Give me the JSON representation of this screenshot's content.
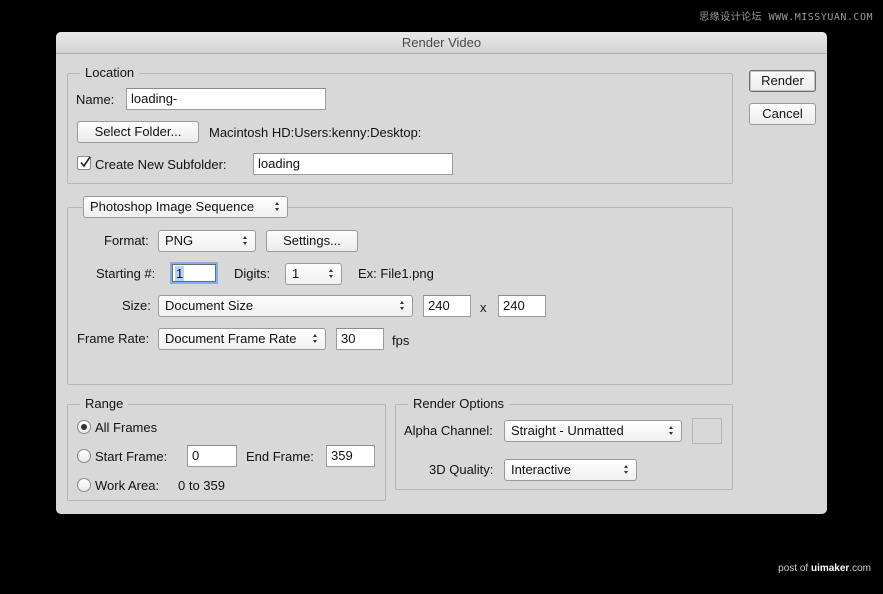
{
  "watermarks": {
    "top": "思缘设计论坛 WWW.MISSYUAN.COM",
    "bottom_prefix": "post of ",
    "bottom_brand": "uimaker",
    "bottom_suffix": ".com"
  },
  "dialog": {
    "title": "Render Video",
    "buttons": {
      "render": "Render",
      "cancel": "Cancel"
    },
    "location": {
      "legend": "Location",
      "name_label": "Name:",
      "name_value": "loading-",
      "select_folder_label": "Select Folder...",
      "folder_path": "Macintosh HD:Users:kenny:Desktop:",
      "create_subfolder_label": "Create New Subfolder:",
      "create_subfolder_checked": true,
      "subfolder_value": "loading"
    },
    "export": {
      "type_selected": "Photoshop Image Sequence",
      "format_label": "Format:",
      "format_selected": "PNG",
      "settings_label": "Settings...",
      "starting_label": "Starting #:",
      "starting_value": "1",
      "digits_label": "Digits:",
      "digits_selected": "1",
      "example_text": "Ex: File1.png",
      "size_label": "Size:",
      "size_selected": "Document Size",
      "width_value": "240",
      "x_label": "x",
      "height_value": "240",
      "frame_rate_label": "Frame Rate:",
      "frame_rate_selected": "Document Frame Rate",
      "fps_value": "30",
      "fps_label": "fps"
    },
    "range": {
      "legend": "Range",
      "all_frames_label": "All Frames",
      "selected": "All Frames",
      "start_frame_label": "Start Frame:",
      "start_frame_value": "0",
      "end_frame_label": "End Frame:",
      "end_frame_value": "359",
      "work_area_label": "Work Area:",
      "work_area_value": "0 to 359"
    },
    "render_options": {
      "legend": "Render Options",
      "alpha_label": "Alpha Channel:",
      "alpha_selected": "Straight - Unmatted",
      "quality_label": "3D Quality:",
      "quality_selected": "Interactive"
    }
  }
}
